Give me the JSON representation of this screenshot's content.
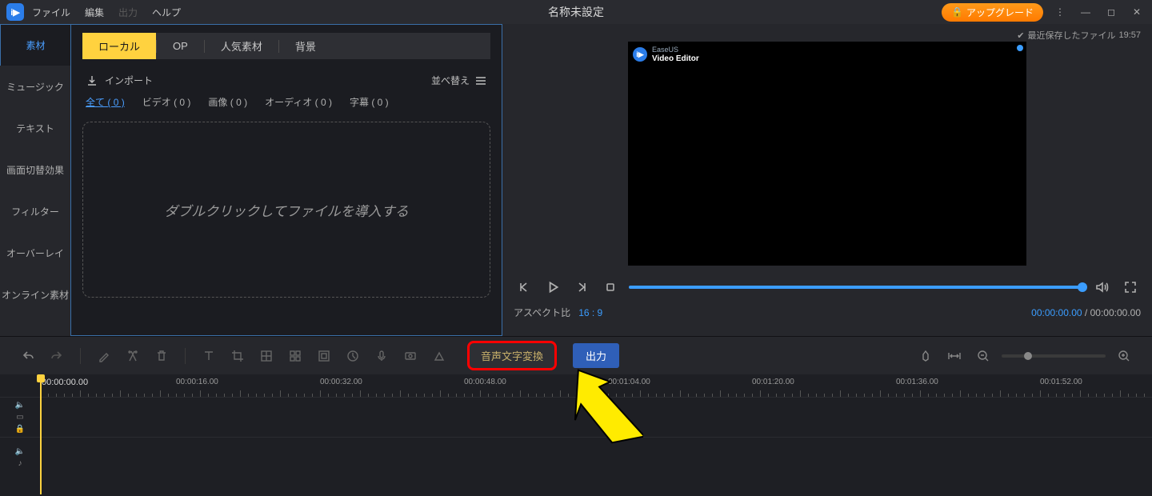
{
  "titlebar": {
    "menus": [
      "ファイル",
      "編集",
      "出力",
      "ヘルプ"
    ],
    "title": "名称未設定",
    "upgrade": "アップグレード"
  },
  "sidebar": {
    "tabs": [
      "素材",
      "ミュージック",
      "テキスト",
      "画面切替効果",
      "フィルター",
      "オーバーレイ",
      "オンライン素材"
    ]
  },
  "media": {
    "tabs": [
      "ローカル",
      "OP",
      "人気素材",
      "背景"
    ],
    "import_label": "インポート",
    "sort_label": "並べ替え",
    "filters": [
      {
        "label": "全て",
        "count": "( 0 )"
      },
      {
        "label": "ビデオ",
        "count": "( 0 )"
      },
      {
        "label": "画像",
        "count": "( 0 )"
      },
      {
        "label": "オーディオ",
        "count": "( 0 )"
      },
      {
        "label": "字幕",
        "count": "( 0 )"
      }
    ],
    "dropzone_text": "ダブルクリックしてファイルを導入する"
  },
  "preview": {
    "recent_save_label": "最近保存したファイル",
    "recent_save_time": "19:57",
    "brand_top": "EaseUS",
    "brand_bottom": "Video Editor",
    "aspect_label": "アスペクト比",
    "aspect_value": "16 : 9",
    "time_current": "00:00:00.00",
    "time_total": "00:00:00.00"
  },
  "toolbar": {
    "speech_to_text": "音声文字変換",
    "export": "出力"
  },
  "timeline": {
    "playhead_time": "00:00:00.00",
    "marks": [
      "00:00:16.00",
      "00:00:32.00",
      "00:00:48.00",
      "00:01:04.00",
      "00:01:20.00",
      "00:01:36.00",
      "00:01:52.00"
    ]
  }
}
